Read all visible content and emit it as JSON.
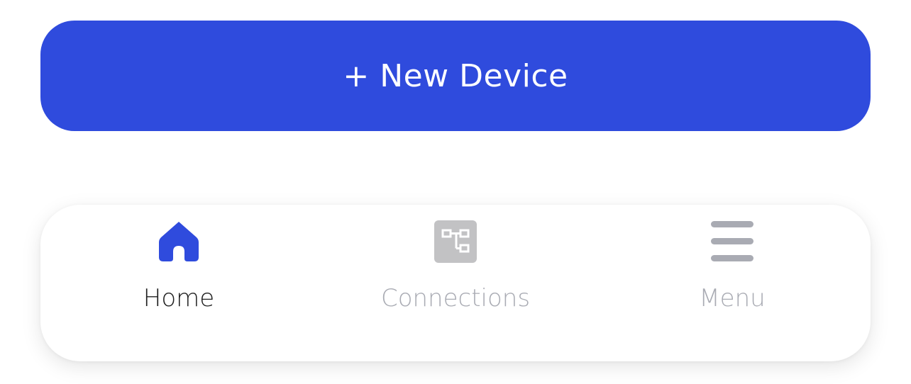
{
  "actions": {
    "new_device_label": "+ New Device"
  },
  "tabbar": {
    "tabs": [
      {
        "label": "Home",
        "icon": "home-icon",
        "active": true
      },
      {
        "label": "Connections",
        "icon": "connections-icon",
        "active": false
      },
      {
        "label": "Menu",
        "icon": "menu-icon",
        "active": false
      }
    ]
  },
  "colors": {
    "accent": "#2f4bdd",
    "inactive": "#a9abb3",
    "active_label": "#1f1f1f"
  }
}
